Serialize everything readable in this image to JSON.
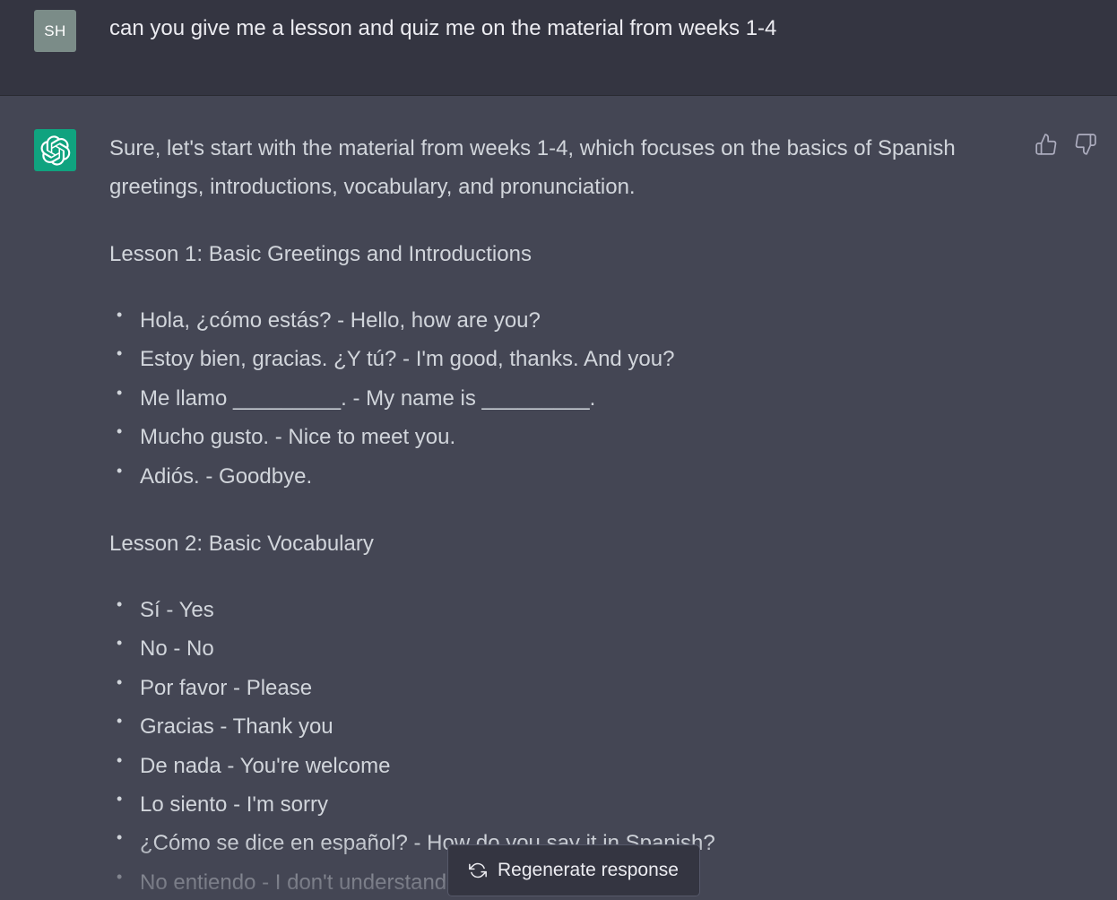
{
  "user_message": {
    "avatar_initials": "SH",
    "text": "can you give me a lesson and quiz me on the material from weeks 1-4"
  },
  "assistant_message": {
    "intro_line1": "Sure, let's start with the material from weeks 1-4, which focuses on the basics of Spanish",
    "intro_line2": "greetings, introductions, vocabulary, and pronunciation.",
    "lessons": [
      {
        "heading": "Lesson 1: Basic Greetings and Introductions",
        "items": [
          "Hola, ¿cómo estás? - Hello, how are you?",
          "Estoy bien, gracias. ¿Y tú? - I'm good, thanks. And you?",
          "Me llamo _________. - My name is _________.",
          "Mucho gusto. - Nice to meet you.",
          "Adiós. - Goodbye."
        ]
      },
      {
        "heading": "Lesson 2: Basic Vocabulary",
        "items": [
          "Sí - Yes",
          "No - No",
          "Por favor - Please",
          "Gracias - Thank you",
          "De nada - You're welcome",
          "Lo siento - I'm sorry",
          "¿Cómo se dice en español? - How do you say it in Spanish?",
          "No entiendo - I don't understand"
        ]
      }
    ]
  },
  "actions": {
    "regenerate_label": "Regenerate response",
    "regenerate_icon": "refresh-icon",
    "thumbs_up_icon": "thumbs-up-icon",
    "thumbs_down_icon": "thumbs-down-icon"
  },
  "colors": {
    "user_bg": "#343541",
    "assistant_bg": "#444654",
    "bot_avatar": "#10a37f",
    "user_avatar": "#7b8c88"
  }
}
